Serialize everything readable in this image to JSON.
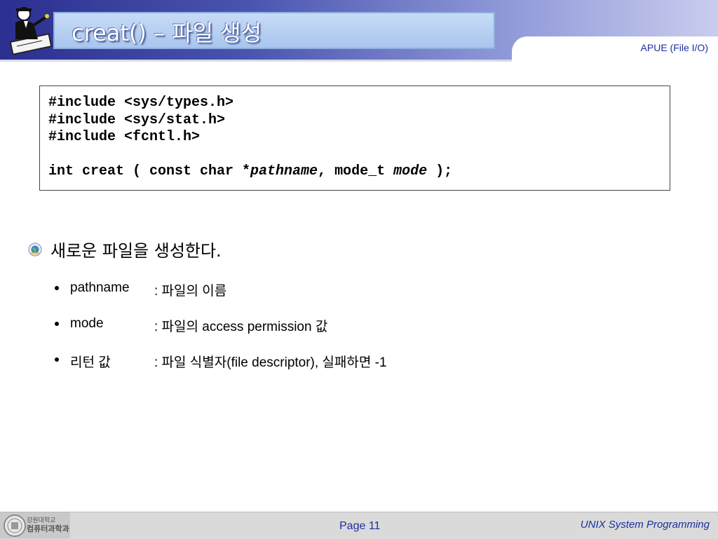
{
  "header": {
    "title": "creat() – 파일 생성",
    "tab_label": "APUE (File I/O)"
  },
  "code": {
    "lines": [
      "#include <sys/types.h>",
      "#include <sys/stat.h>",
      "#include <fcntl.h>"
    ],
    "signature": {
      "prefix": "int creat ( const char *",
      "arg1": "pathname",
      "middle": ", mode_t ",
      "arg2": "mode",
      "suffix": " );"
    }
  },
  "content": {
    "main_bullet": "새로운 파일을 생성한다.",
    "items": [
      {
        "term": "pathname",
        "desc": ": 파일의 이름"
      },
      {
        "term": "mode",
        "desc": ": 파일의 access permission 값"
      },
      {
        "term": "리턴 값",
        "desc": ": 파일 식별자(file descriptor), 실패하면 -1"
      }
    ]
  },
  "footer": {
    "university_line1": "강원대학교",
    "university_line2": "컴퓨터과학과",
    "page": "Page 11",
    "course": "UNIX System Programming"
  },
  "colors": {
    "accent": "#1b2fa0",
    "header_dark": "#2b2f8f",
    "header_light": "#c9cdee"
  },
  "icons": {
    "logo": "man-writing-icon",
    "bullet": "globe-bullet-icon",
    "footer_logo": "university-seal-icon"
  }
}
